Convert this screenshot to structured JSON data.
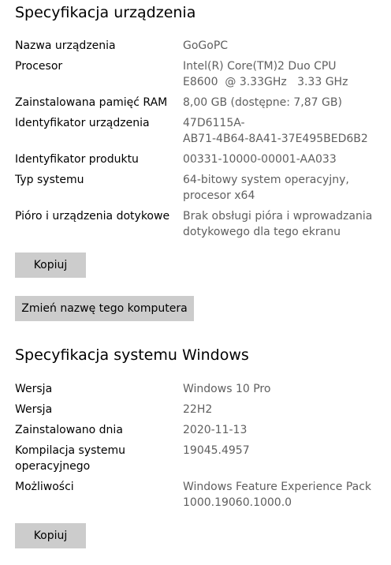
{
  "device": {
    "title": "Specyfikacja urządzenia",
    "rows": [
      {
        "label": "Nazwa urządzenia",
        "value": [
          "GoGoPC"
        ]
      },
      {
        "label": "Procesor",
        "value": [
          "Intel(R) Core(TM)2 Duo CPU",
          "E8600  @ 3.33GHz   3.33 GHz"
        ]
      },
      {
        "label": "Zainstalowana pamięć RAM",
        "value": [
          "8,00 GB (dostępne: 7,87 GB)"
        ]
      },
      {
        "label": "Identyfikator urządzenia",
        "value": [
          "47D6115A-",
          "AB71-4B64-8A41-37E495BED6B2"
        ]
      },
      {
        "label": "Identyfikator produktu",
        "value": [
          "00331-10000-00001-AA033"
        ]
      },
      {
        "label": "Typ systemu",
        "value": [
          "64-bitowy system operacyjny,",
          "procesor x64"
        ]
      },
      {
        "label": "Pióro i urządzenia dotykowe",
        "value": [
          "Brak obsługi pióra i wprowadzania",
          "dotykowego dla tego ekranu"
        ]
      }
    ],
    "copy_label": "Kopiuj",
    "rename_label": "Zmień nazwę tego komputera"
  },
  "windows": {
    "title": "Specyfikacja systemu Windows",
    "rows": [
      {
        "label": [
          "Wersja"
        ],
        "value": [
          "Windows 10 Pro"
        ]
      },
      {
        "label": [
          "Wersja"
        ],
        "value": [
          "22H2"
        ]
      },
      {
        "label": [
          "Zainstalowano dnia"
        ],
        "value": [
          "2020-11-13"
        ]
      },
      {
        "label": [
          "Kompilacja systemu",
          "operacyjnego"
        ],
        "value": [
          "19045.4957"
        ]
      },
      {
        "label": [
          "Możliwości"
        ],
        "value": [
          "Windows Feature Experience Pack",
          "1000.19060.1000.0"
        ]
      }
    ],
    "copy_label": "Kopiuj"
  }
}
